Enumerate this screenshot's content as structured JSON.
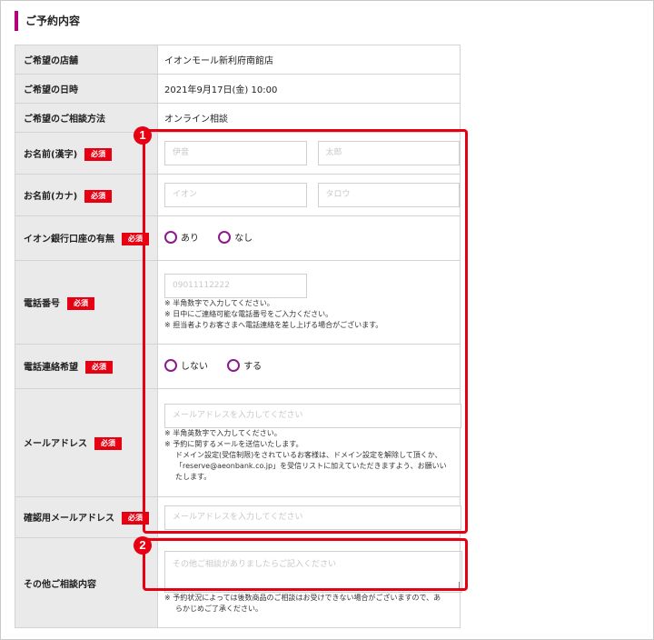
{
  "section_title": "ご予約内容",
  "rows": {
    "store": {
      "label": "ご希望の店舗",
      "value": "イオンモール新利府南館店"
    },
    "date": {
      "label": "ご希望の日時",
      "value": "2021年9月17日(金) 10:00"
    },
    "method": {
      "label": "ご希望のご相談方法",
      "value": "オンライン相談"
    },
    "name_kanji": {
      "label": "お名前(漢字)",
      "placeholder_last": "伊音",
      "placeholder_first": "太郎"
    },
    "name_kana": {
      "label": "お名前(カナ)",
      "placeholder_last": "イオン",
      "placeholder_first": "タロウ"
    },
    "account": {
      "label": "イオン銀行口座の有無",
      "option_yes": "あり",
      "option_no": "なし"
    },
    "phone": {
      "label": "電話番号",
      "placeholder": "09011112222",
      "notes": [
        "※ 半角数字で入力してください。",
        "※ 日中にご連絡可能な電話番号をご入力ください。",
        "※ 担当者よりお客さまへ電話連絡を差し上げる場合がございます。"
      ]
    },
    "phone_contact": {
      "label": "電話連絡希望",
      "option_no": "しない",
      "option_yes": "する"
    },
    "email": {
      "label": "メールアドレス",
      "placeholder": "メールアドレスを入力してください",
      "note1": "※ 半角英数字で入力してください。",
      "note2": "※ 予約に関するメールを送信いたします。",
      "note3": "ドメイン設定(受信制限)をされているお客様は、ドメイン設定を解除して頂くか、",
      "note4": "「reserve@aeonbank.co.jp」を受信リストに加えていただきますよう、お願いい",
      "note5": "たします。"
    },
    "email_confirm": {
      "label": "確認用メールアドレス",
      "placeholder": "メールアドレスを入力してください"
    },
    "other": {
      "label": "その他ご相談内容",
      "placeholder": "その他ご相談がありましたらご記入ください",
      "note1": "※ 予約状況によっては後数商品のご相談はお受けできない場合がございますので、あ",
      "note2": "らかじめご了承ください。"
    }
  },
  "required_badge": "必須",
  "callouts": {
    "one": "1",
    "two": "2"
  },
  "colors": {
    "accent": "#b4007a",
    "required": "#e60012",
    "callout": "#e60012",
    "radio": "#8b1a8b"
  }
}
